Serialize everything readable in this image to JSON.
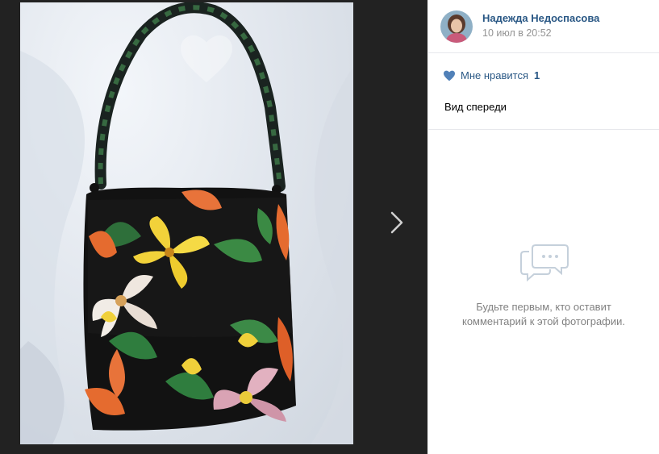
{
  "author": {
    "name": "Надежда Недоспасова",
    "date": "10 июл в 20:52"
  },
  "likes": {
    "label": "Мне нравится",
    "count": "1"
  },
  "caption": "Вид спереди",
  "comments": {
    "empty_line1": "Будьте первым, кто оставит",
    "empty_line2": "комментарий к этой фотографии."
  },
  "icons": {
    "like": "heart-icon",
    "next": "chevron-right-icon",
    "empty_comments": "chat-bubbles-icon"
  },
  "colors": {
    "link": "#2a5885",
    "viewer_bg": "#222222",
    "like_heart": "#5181b8",
    "muted_text": "#828282"
  }
}
